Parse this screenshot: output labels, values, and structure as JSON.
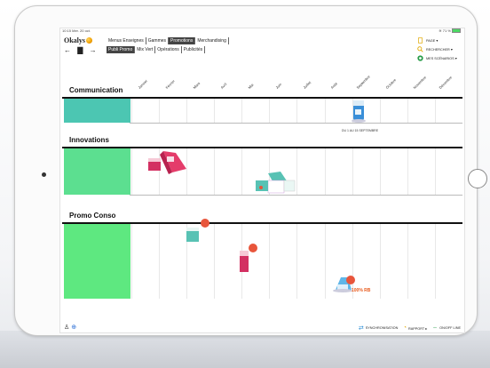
{
  "status": {
    "left": "10:15  Mer. 20 oct.",
    "right": "71 %"
  },
  "app": {
    "logo": "Okalys"
  },
  "tabs_row1": [
    "Menus Enseignes",
    "Gammes",
    "Promotions",
    "Merchandising"
  ],
  "tabs_row1_active": "Promotions",
  "tabs_row2": [
    "Publi Promo",
    "Mix Vert",
    "Opérations",
    "Publicités"
  ],
  "tabs_row2_active": "Publi Promo",
  "right_menu": {
    "page": "PAGE ▾",
    "search": "RECHERCHER ▾",
    "scenarios": "MES SCÉNARIOS ▾"
  },
  "months": [
    "Janvier",
    "Février",
    "Mars",
    "Avril",
    "Mai",
    "Juin",
    "Juillet",
    "Août",
    "Septembre",
    "Octobre",
    "Novembre",
    "Décembre"
  ],
  "sections": {
    "communication": "Communication",
    "innovations": "Innovations",
    "promo": "Promo Conso"
  },
  "notes": {
    "communication_date": "DU 1 AU 15 SEPTEMBRE",
    "promo_rb": "100% RB"
  },
  "footer": {
    "sync": "SYNCHRONISATION",
    "rapport": "RAPPORT ▸",
    "online": "ON/OFF LINE"
  },
  "colors": {
    "communication": "#4cc6b2",
    "innovations": "#5cdf90",
    "promo": "#5ee880",
    "active_tab": "#444444"
  }
}
